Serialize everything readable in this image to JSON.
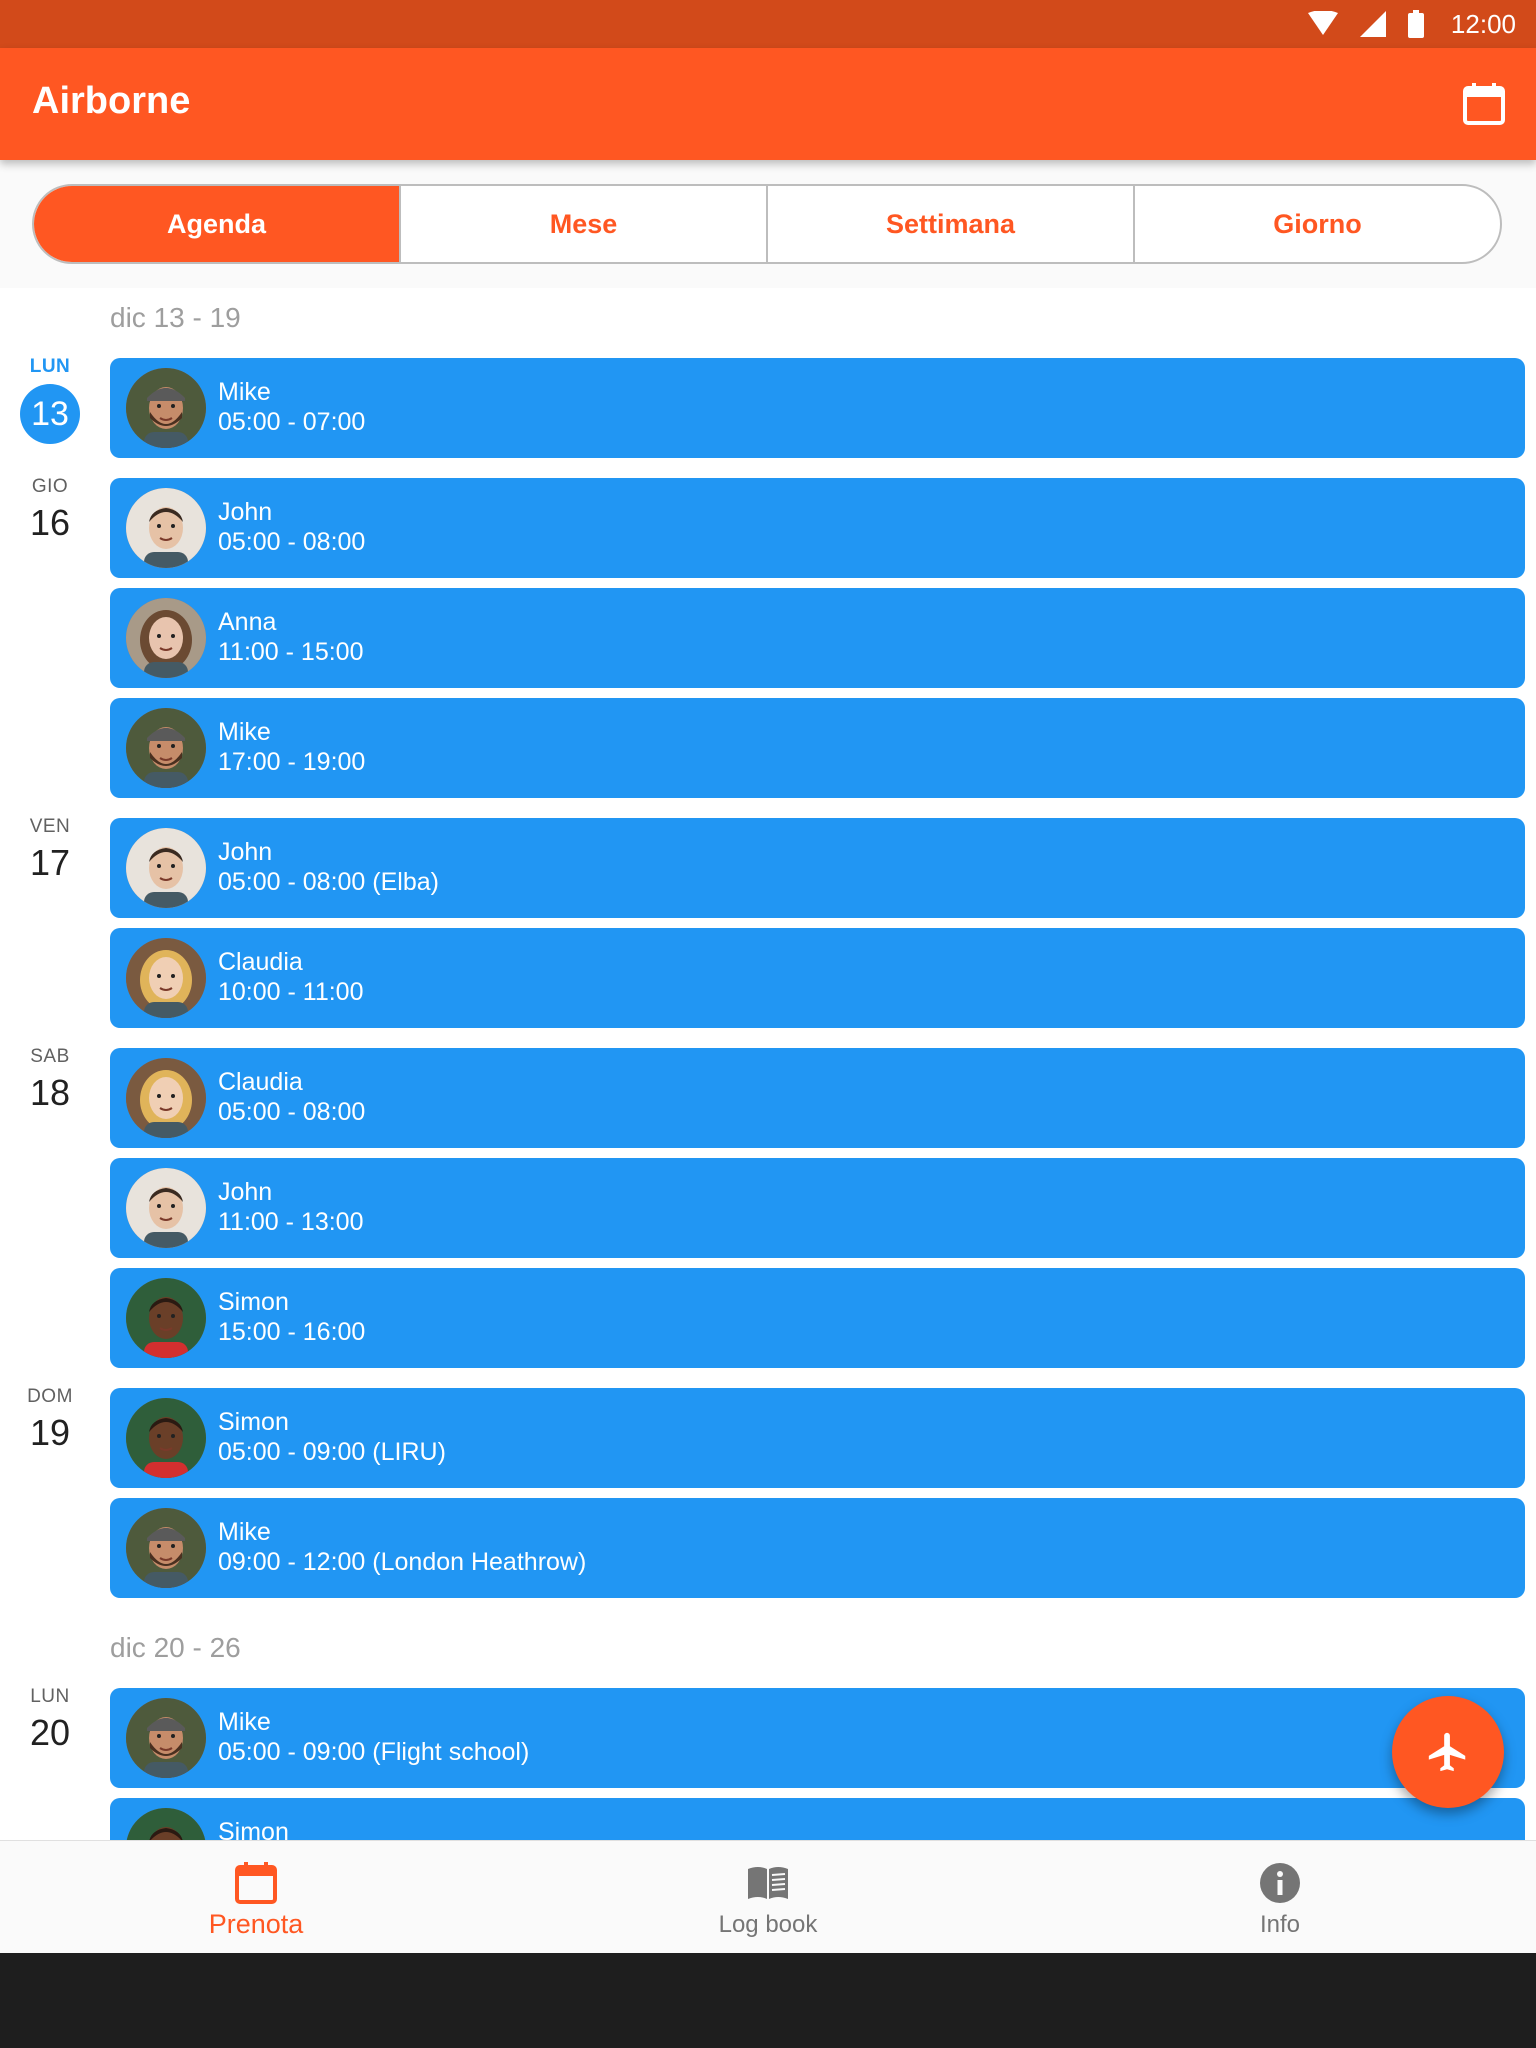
{
  "status_bar": {
    "time": "12:00"
  },
  "app_bar": {
    "title": "Airborne"
  },
  "tabs": [
    {
      "label": "Agenda",
      "active": true
    },
    {
      "label": "Mese",
      "active": false
    },
    {
      "label": "Settimana",
      "active": false
    },
    {
      "label": "Giorno",
      "active": false
    }
  ],
  "agenda": {
    "weeks": [
      {
        "label": "dic 13 - 19"
      },
      {
        "label": "dic 20 - 26"
      }
    ],
    "days": [
      {
        "abbr": "LUN",
        "num": "13",
        "today": true
      },
      {
        "abbr": "GIO",
        "num": "16"
      },
      {
        "abbr": "VEN",
        "num": "17"
      },
      {
        "abbr": "SAB",
        "num": "18"
      },
      {
        "abbr": "DOM",
        "num": "19"
      },
      {
        "abbr": "LUN",
        "num": "20"
      }
    ],
    "events": [
      {
        "name": "Mike",
        "time": "05:00 - 07:00",
        "avatar": "mike"
      },
      {
        "name": "John",
        "time": "05:00 - 08:00",
        "avatar": "john"
      },
      {
        "name": "Anna",
        "time": "11:00 - 15:00",
        "avatar": "anna"
      },
      {
        "name": "Mike",
        "time": "17:00 - 19:00",
        "avatar": "mike"
      },
      {
        "name": "John",
        "time": "05:00 - 08:00 (Elba)",
        "avatar": "john"
      },
      {
        "name": "Claudia",
        "time": "10:00 - 11:00",
        "avatar": "claudia"
      },
      {
        "name": "Claudia",
        "time": "05:00 - 08:00",
        "avatar": "claudia"
      },
      {
        "name": "John",
        "time": "11:00 - 13:00",
        "avatar": "john"
      },
      {
        "name": "Simon",
        "time": "15:00 - 16:00",
        "avatar": "simon"
      },
      {
        "name": "Simon",
        "time": "05:00 - 09:00 (LIRU)",
        "avatar": "simon"
      },
      {
        "name": "Mike",
        "time": "09:00 - 12:00 (London Heathrow)",
        "avatar": "mike"
      },
      {
        "name": "Mike",
        "time": "05:00 - 09:00 (Flight school)",
        "avatar": "mike"
      },
      {
        "name": "Simon",
        "time": "",
        "avatar": "simon"
      }
    ]
  },
  "bottom_nav": [
    {
      "label": "Prenota",
      "icon": "calendar-icon",
      "active": true
    },
    {
      "label": "Log book",
      "icon": "book-icon",
      "active": false
    },
    {
      "label": "Info",
      "icon": "info-icon",
      "active": false
    }
  ],
  "colors": {
    "primary": "#ff5722",
    "status_bar": "#d24a1a",
    "event": "#2196f3"
  }
}
